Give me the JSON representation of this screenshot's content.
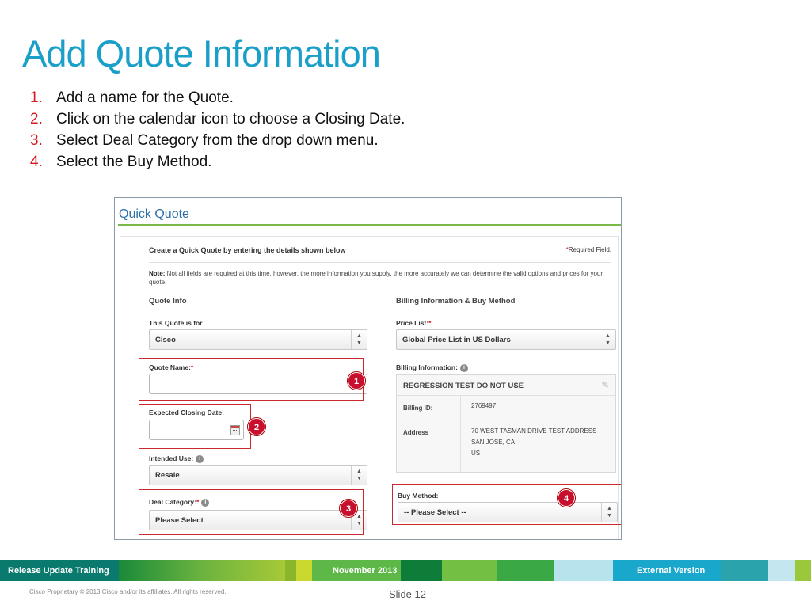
{
  "slide": {
    "title": "Add Quote Information",
    "steps": [
      {
        "num": "1.",
        "text": "Add a name for the Quote."
      },
      {
        "num": "2.",
        "text": "Click on the calendar icon to choose a Closing Date."
      },
      {
        "num": "3.",
        "text": "Select Deal Category from the drop down menu."
      },
      {
        "num": "4.",
        "text": "Select the Buy Method."
      }
    ]
  },
  "form": {
    "header": "Quick Quote",
    "intro": "Create a Quick Quote by entering the details shown below",
    "required_star": "*",
    "required_label": "Required Field.",
    "note_label": "Note:",
    "note_text": " Not all fields are required at this time, however, the more information you supply, the more accurately we can determine the valid options and prices for your quote.",
    "quote_info": {
      "heading": "Quote Info",
      "this_quote_label": "This Quote is for",
      "this_quote_value": "Cisco",
      "quote_name_label": "Quote Name:",
      "quote_name_value": "",
      "closing_date_label": "Expected Closing Date:",
      "closing_date_value": "",
      "intended_use_label": "Intended Use:",
      "intended_use_value": "Resale",
      "deal_category_label": "Deal Category:",
      "deal_category_value": "Please Select"
    },
    "billing": {
      "heading": "Billing Information & Buy Method",
      "price_list_label": "Price List:",
      "price_list_value": "Global Price List in US Dollars",
      "billing_info_label": "Billing Information:",
      "account_name": "REGRESSION TEST DO NOT USE",
      "billing_id_label": "Billing ID:",
      "billing_id_value": "2769497",
      "address_label": "Address",
      "address_line1": "70 WEST TASMAN DRIVE TEST ADDRESS",
      "address_line2": "SAN JOSE, CA",
      "address_line3": "US",
      "buy_method_label": "Buy Method:",
      "buy_method_value": "-- Please Select --"
    },
    "callouts": [
      "1",
      "2",
      "3",
      "4"
    ],
    "info_glyph": "i",
    "arrow_up": "▲",
    "arrow_down": "▼",
    "pencil_glyph": "✎"
  },
  "footer": {
    "left": "Release Update Training",
    "center": "November 2013",
    "right": "External Version",
    "copyright": "Cisco Proprietary © 2013 Cisco and/or its affiliates. All rights reserved.",
    "slide_label": "Slide 12"
  },
  "colors": {
    "title": "#1a9fc9",
    "step_number": "#d71921",
    "callout": "#c8102e",
    "header_rule": "#7ab84a"
  }
}
